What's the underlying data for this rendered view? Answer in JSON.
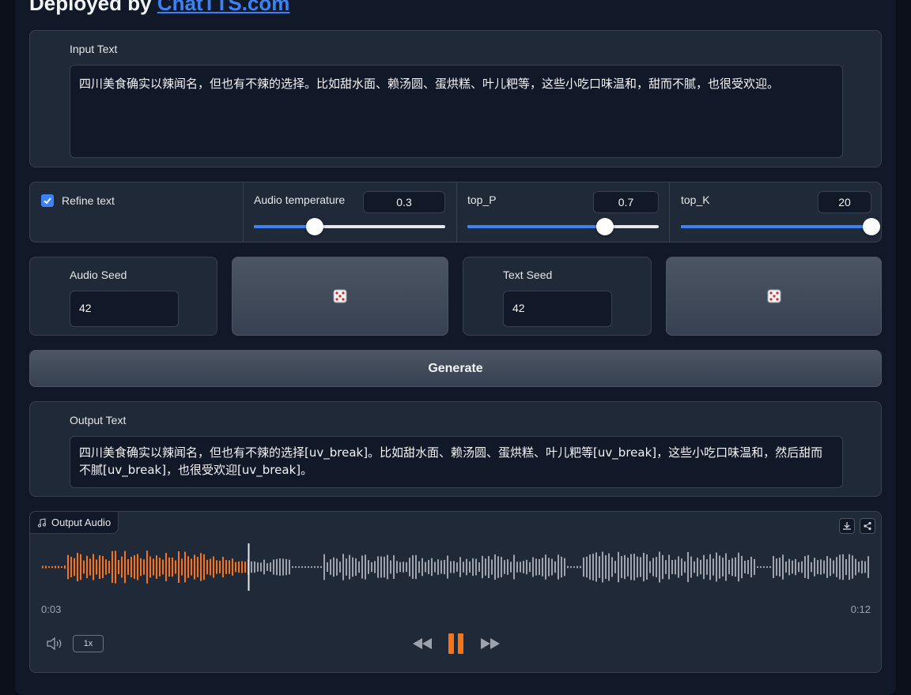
{
  "header": {
    "prefix": "Deployed by ",
    "link": "ChatTTS.com"
  },
  "input_text": {
    "label": "Input Text",
    "value": "四川美食确实以辣闻名，但也有不辣的选择。比如甜水面、赖汤圆、蛋烘糕、叶儿粑等，这些小吃口味温和，甜而不腻，也很受欢迎。"
  },
  "controls": {
    "refine_label": "Refine text",
    "refine_checked": true,
    "audio_temperature": {
      "label": "Audio temperature",
      "value": "0.3",
      "fraction": 0.32
    },
    "top_p": {
      "label": "top_P",
      "value": "0.7",
      "fraction": 0.72
    },
    "top_k": {
      "label": "top_K",
      "value": "20",
      "fraction": 1.0
    }
  },
  "seeds": {
    "audio_label": "Audio Seed",
    "audio_value": "42",
    "text_label": "Text Seed",
    "text_value": "42",
    "dice_icon": "dice-icon"
  },
  "generate_label": "Generate",
  "output_text": {
    "label": "Output Text",
    "value": "四川美食确实以辣闻名，但也有不辣的选择[uv_break]。比如甜水面、赖汤圆、蛋烘糕、叶儿粑等[uv_break]，这些小吃口味温和，然后甜而不腻[uv_break]，也很受欢迎[uv_break]。"
  },
  "audio": {
    "label": "Output Audio",
    "current_time": "0:03",
    "duration": "0:12",
    "playback_speed": "1x",
    "played_fraction": 0.25,
    "colors": {
      "played": "#f97316",
      "unplayed": "#9ca3af",
      "accent": "#3b82f6"
    }
  }
}
